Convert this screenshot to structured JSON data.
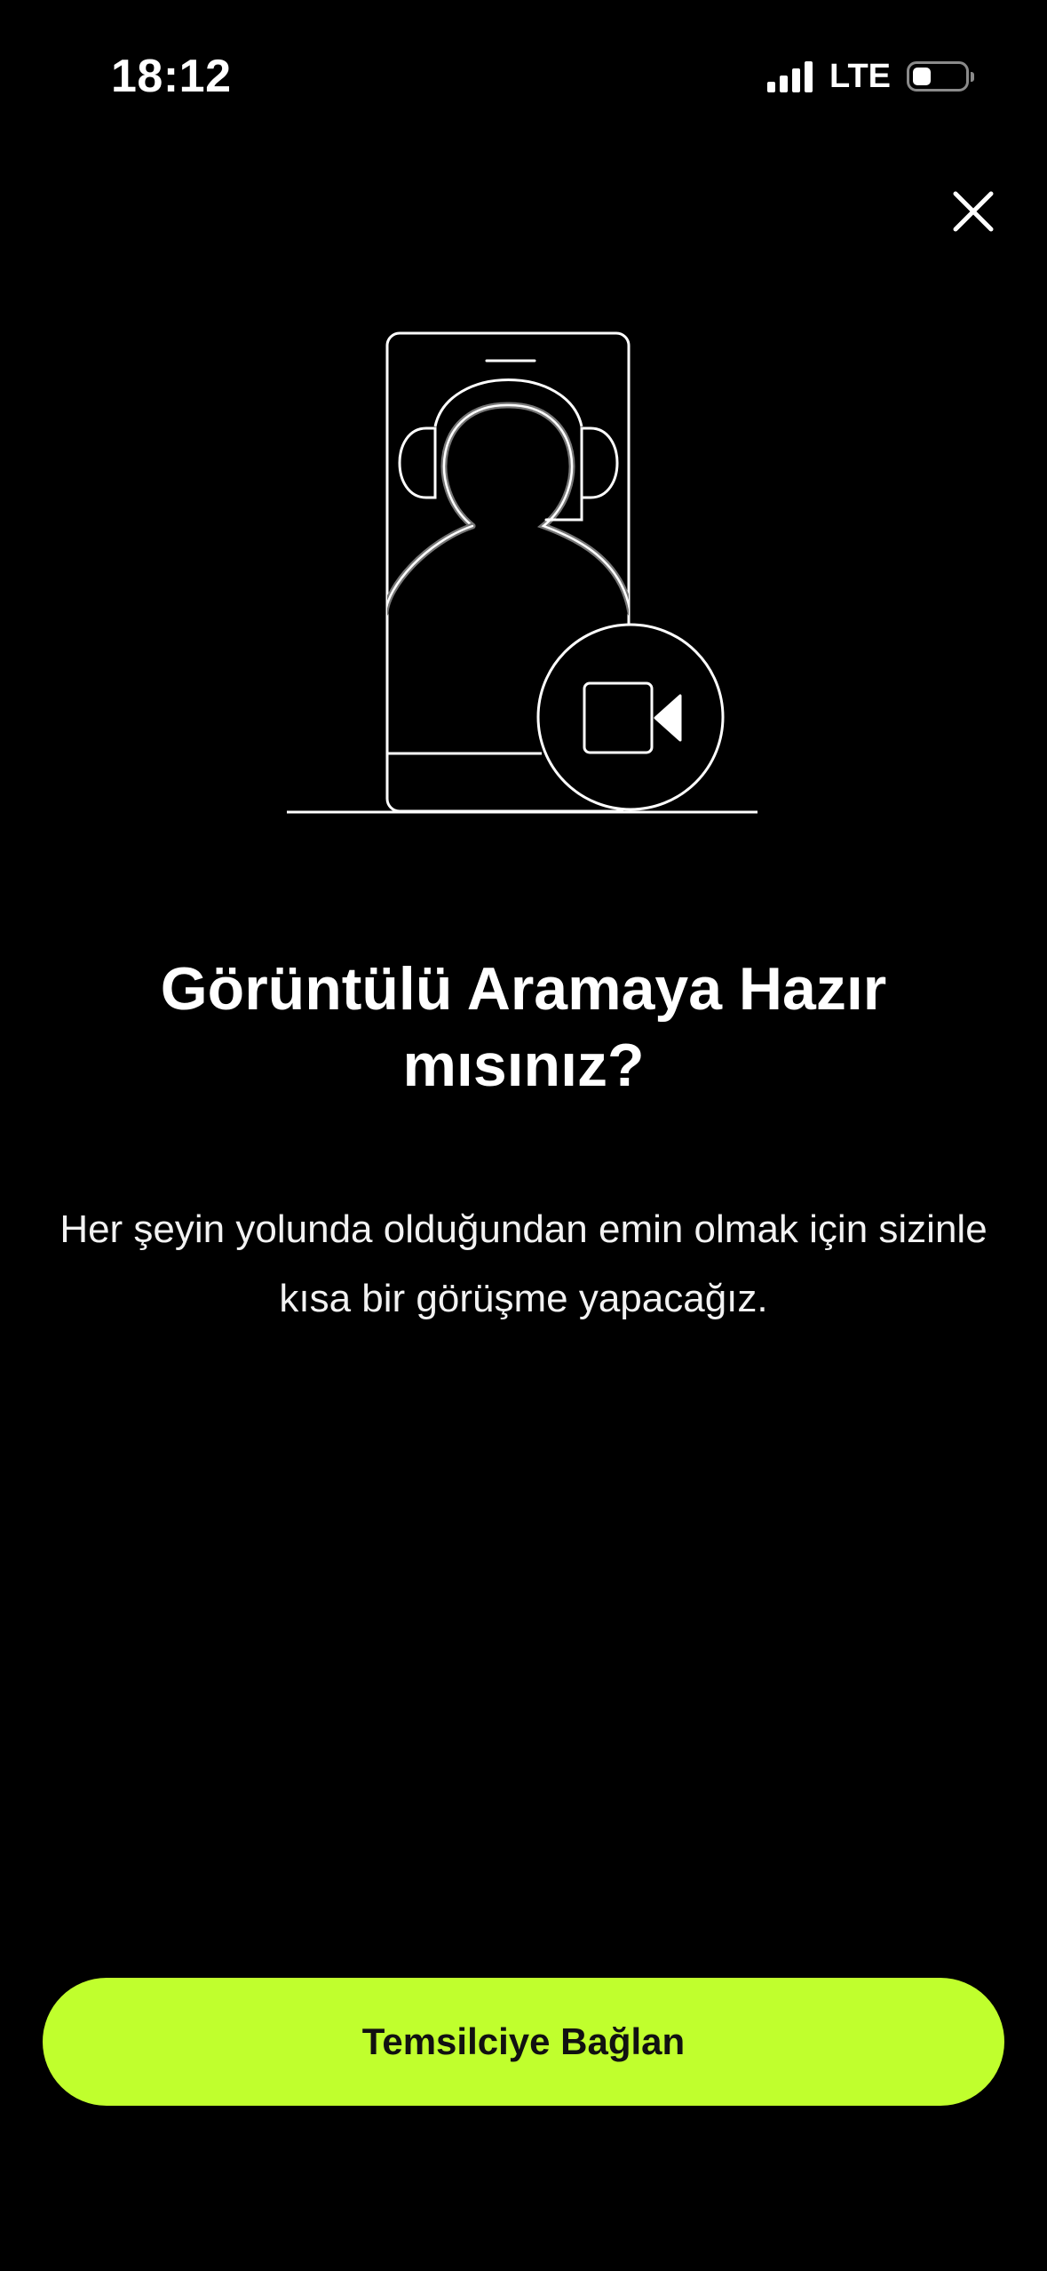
{
  "status_bar": {
    "time": "18:12",
    "network": "LTE",
    "icons": [
      "signal-icon",
      "battery-icon"
    ]
  },
  "header": {
    "close_icon": "close-icon"
  },
  "illustration": {
    "icon": "agent-video-call-illustration"
  },
  "content": {
    "title": "Görüntülü Aramaya Hazır mısınız?",
    "description": "Her şeyin yolunda olduğundan emin olmak için sizinle kısa bir görüşme yapacağız."
  },
  "actions": {
    "connect_label": "Temsilciye Bağlan"
  },
  "colors": {
    "background": "#000000",
    "accent": "#c0ff2d",
    "text": "#ffffff"
  }
}
